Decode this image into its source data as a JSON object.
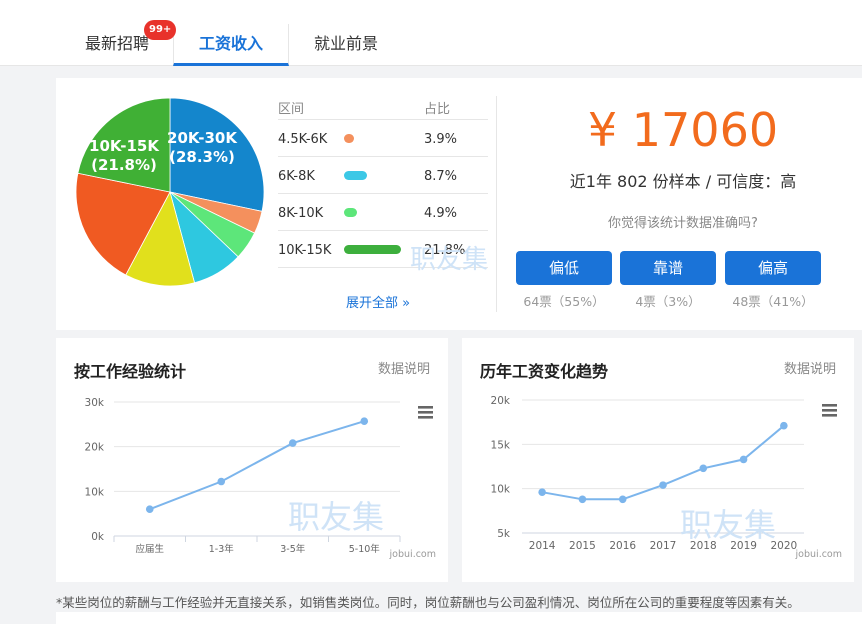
{
  "tabs": [
    {
      "label": "最新招聘",
      "badge": "99+"
    },
    {
      "label": "工资收入"
    },
    {
      "label": "就业前景"
    }
  ],
  "distribution": {
    "header": {
      "range": "区间",
      "ratio": "占比"
    },
    "rows": [
      {
        "range": "4.5K-6K",
        "ratio": "3.9%",
        "color": "#f4905d"
      },
      {
        "range": "6K-8K",
        "ratio": "8.7%",
        "color": "#3cc8e6"
      },
      {
        "range": "8K-10K",
        "ratio": "4.9%",
        "color": "#5de67a"
      },
      {
        "range": "10K-15K",
        "ratio": "21.8%",
        "color": "#3daf3d"
      }
    ],
    "expand": "展开全部 »",
    "watermark": "职友集"
  },
  "pie": {
    "chart_data": {
      "type": "pie",
      "slices": [
        {
          "label": "20K-30K",
          "pct_text": "(28.3%)",
          "value": 28.3,
          "color": "#1486cc"
        },
        {
          "label": "",
          "value": 3.9,
          "color": "#f4905d"
        },
        {
          "label": "",
          "value": 4.9,
          "color": "#5de67a"
        },
        {
          "label": "",
          "value": 8.7,
          "color": "#2ec8e0"
        },
        {
          "label": "",
          "value": 12.0,
          "color": "#e1e01c"
        },
        {
          "label": "",
          "value": 20.4,
          "color": "#f05a22"
        },
        {
          "label": "10K-15K",
          "pct_text": "(21.8%)",
          "value": 21.8,
          "color": "#40b035"
        }
      ]
    }
  },
  "salary": {
    "amount": "¥ 17060",
    "sample_text": "近1年 802 份样本 / 可信度：高",
    "question": "你觉得该统计数据准确吗?",
    "votes": [
      {
        "label": "偏低",
        "count": "64票（55%）"
      },
      {
        "label": "靠谱",
        "count": "4票（3%）"
      },
      {
        "label": "偏高",
        "count": "48票（41%）"
      }
    ]
  },
  "experience": {
    "title": "按工作经验统计",
    "desc": "数据说明",
    "watermark": "职友集",
    "credit": "jobui.com",
    "chart_data": {
      "type": "line",
      "categories": [
        "应届生",
        "1-3年",
        "3-5年",
        "5-10年"
      ],
      "values": [
        6000,
        12200,
        20800,
        25700
      ],
      "ylim": [
        0,
        30000
      ],
      "yticks": [
        "0k",
        "10k",
        "20k",
        "30k"
      ],
      "ytick_values": [
        0,
        10000,
        20000,
        30000
      ],
      "color": "#7cb5ec",
      "grid": true
    }
  },
  "trend": {
    "title": "历年工资变化趋势",
    "desc": "数据说明",
    "watermark": "职友集",
    "credit": "jobui.com",
    "chart_data": {
      "type": "line",
      "categories": [
        "2014",
        "2015",
        "2016",
        "2017",
        "2018",
        "2019",
        "2020"
      ],
      "values": [
        9600,
        8800,
        8800,
        10400,
        12300,
        13300,
        17100
      ],
      "ylim": [
        5000,
        20000
      ],
      "yticks": [
        "5k",
        "10k",
        "15k",
        "20k"
      ],
      "ytick_values": [
        5000,
        10000,
        15000,
        20000
      ],
      "color": "#7cb5ec",
      "grid": true
    }
  },
  "footnote": "*某些岗位的薪酬与工作经验并无直接关系，如销售类岗位。同时，岗位薪酬也与公司盈利情况、岗位所在公司的重要程度等因素有关。"
}
